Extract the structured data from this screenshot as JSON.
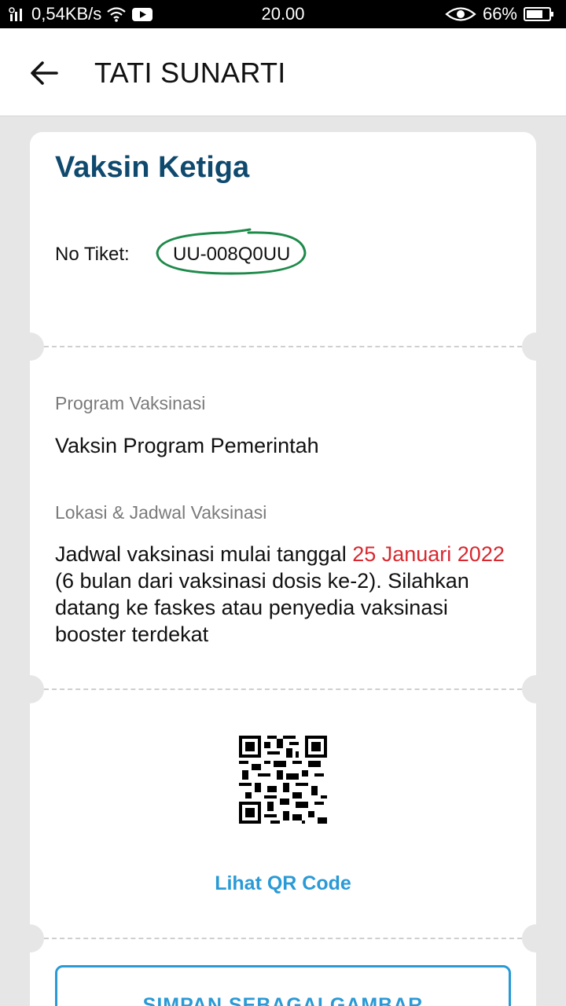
{
  "status_bar": {
    "network_speed": "0,54KB/s",
    "time": "20.00",
    "battery": "66%"
  },
  "header": {
    "title": "TATI SUNARTI",
    "back_icon": "arrow-left-icon"
  },
  "card": {
    "title": "Vaksin Ketiga",
    "ticket_label": "No Tiket:",
    "ticket_number": "UU-008Q0UU",
    "program_label": "Program Vaksinasi",
    "program_value": "Vaksin Program Pemerintah",
    "location_label": "Lokasi & Jadwal Vaksinasi",
    "schedule_prefix": "Jadwal vaksinasi mulai tanggal ",
    "schedule_date": "25 Januari 2022",
    "schedule_suffix": " (6 bulan dari vaksinasi dosis ke-2). Silahkan datang ke faskes atau penyedia vaksinasi booster terdekat",
    "qr_link_label": "Lihat QR Code",
    "save_button_label": "SIMPAN SEBAGAI GAMBAR"
  },
  "colors": {
    "title_blue": "#0f4a6e",
    "link_blue": "#2a9ad6",
    "highlight_red": "#d8282f",
    "annotation_green": "#1e8a4a"
  }
}
